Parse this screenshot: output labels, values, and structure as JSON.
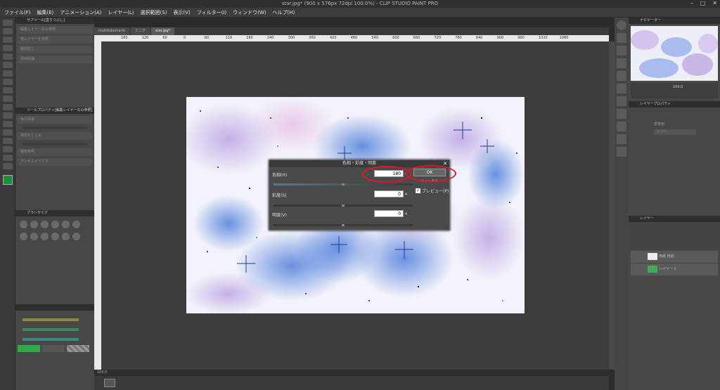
{
  "window": {
    "title": "star.jpg* (900 x 576px 72dpi 100.0%) - CLIP STUDIO PAINT PRO"
  },
  "menu": [
    "ファイル(F)",
    "編集(E)",
    "アニメーション(A)",
    "レイヤー(L)",
    "選択範囲(S)",
    "表示(V)",
    "フィルター(I)",
    "ウィンドウ(W)",
    "ヘルプ(H)"
  ],
  "left_panel": {
    "subtool_title": "サブツール[塗りつぶし]",
    "tool_property_title": "ツールプロパティ[編集レイヤーのみ参照]",
    "rows": [
      "編集レイヤーのみ参照",
      "他レイヤーを参照",
      "隙間閉じ",
      "領域拡縮",
      "色の誤差",
      "隙間をとじる",
      "複数参照",
      "アンチエイリアス"
    ],
    "brush_size_title": "ブラシサイズ"
  },
  "tabs": [
    {
      "label": "multitokomario"
    },
    {
      "label": "ミニク"
    },
    {
      "label": "star.jpg*"
    }
  ],
  "ruler": {
    "ticks": [
      "180",
      "120",
      "60",
      "0",
      "60",
      "120",
      "180",
      "240",
      "300",
      "360",
      "420",
      "480",
      "540",
      "600",
      "660",
      "720",
      "780",
      "840",
      "900",
      "960",
      "1020",
      "1080"
    ]
  },
  "status": {
    "zoom": "100.0"
  },
  "right_panel": {
    "navigator_title": "ナビゲーター",
    "navigator_zoom": "100.0",
    "layer_property_title": "レイヤープロパティ",
    "layer_property_label": "表現色",
    "layer_property_color": "カラー",
    "layer_tab": "レイヤー",
    "layers": [
      {
        "name": "用紙 用紙"
      },
      {
        "name": "レイヤー 1"
      }
    ]
  },
  "dialog": {
    "title": "色相・彩度・明度",
    "hue_label": "色相(H)",
    "hue_value": "180",
    "saturation_label": "彩度(S)",
    "saturation_value": "0",
    "brightness_label": "明度(V)",
    "brightness_value": "0",
    "ok_label": "OK",
    "cancel_label": "キャンセル",
    "preview_label": "プレビュー(P)",
    "preview_check": "✓",
    "close_glyph": "✕"
  },
  "colors": {
    "highlight": "#d8192b",
    "main_color": "#1e8f3a"
  }
}
